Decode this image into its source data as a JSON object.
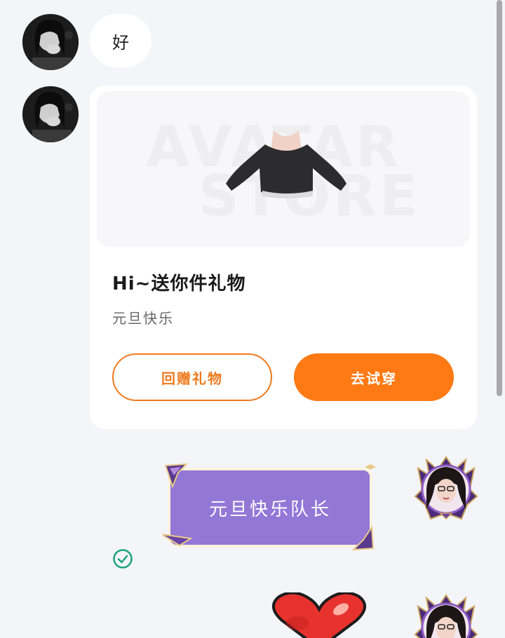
{
  "messages": {
    "incoming_text": "好",
    "gift_card": {
      "image_watermark_line1": "AVATAR",
      "image_watermark_line2": "STORE",
      "title": "Hi~送你件礼物",
      "subtitle": "元旦快乐",
      "return_gift_button": "回赠礼物",
      "try_on_button": "去试穿"
    },
    "outgoing_text": "元旦快乐队长"
  },
  "colors": {
    "accent_orange": "#ff7a14",
    "bubble_purple": "#9277d6",
    "sent_check_green": "#1aa37a",
    "background": "#f4f5f9"
  },
  "icons": {
    "sent_status": "check-circle-icon",
    "sticker": "heart-icon"
  }
}
